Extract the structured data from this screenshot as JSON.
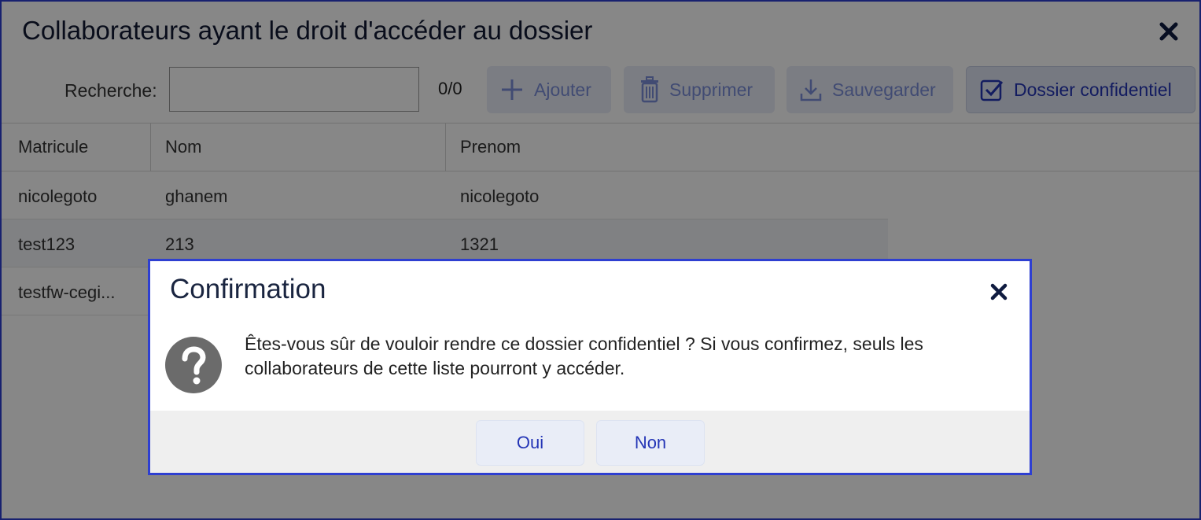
{
  "window": {
    "title": "Collaborateurs ayant le droit d'accéder au dossier",
    "close_icon": "close-icon"
  },
  "toolbar": {
    "search_label": "Recherche:",
    "search_value": "",
    "counter": "0/0",
    "add_label": "Ajouter",
    "delete_label": "Supprimer",
    "save_label": "Sauvegarder",
    "confidential_label": "Dossier confidentiel"
  },
  "table": {
    "columns": [
      "Matricule",
      "Nom",
      "Prenom"
    ],
    "rows": [
      [
        "nicolegoto",
        "ghanem",
        "nicolegoto"
      ],
      [
        "test123",
        "213",
        "1321"
      ],
      [
        "testfw-cegi...",
        "",
        ""
      ]
    ]
  },
  "dialog": {
    "title": "Confirmation",
    "message": "Êtes-vous sûr de vouloir rendre ce dossier confidentiel ? Si vous confirmez, seuls les collaborateurs de cette liste pourront y accéder.",
    "yes_label": "Oui",
    "no_label": "Non"
  },
  "colors": {
    "accent_border": "#2e3fd1",
    "button_text": "#2435b6",
    "overlay": "rgba(0,0,0,0.47)"
  }
}
